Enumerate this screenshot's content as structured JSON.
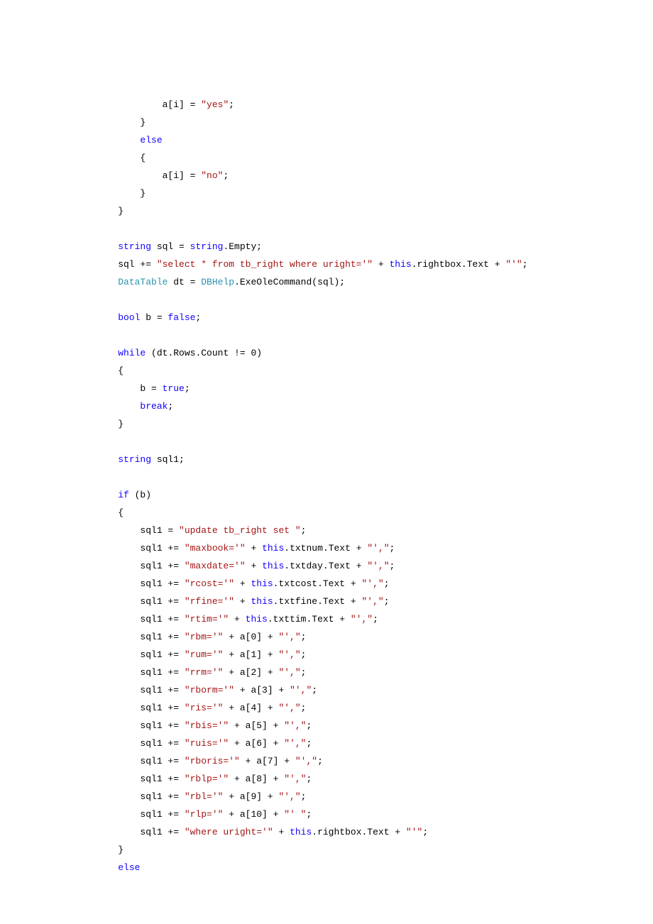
{
  "code": {
    "l1": "            a[i] = \"yes\";",
    "l2": "        }",
    "l3": "        else",
    "l4": "        {",
    "l5": "            a[i] = \"no\";",
    "l6": "        }",
    "l7": "    }",
    "l8": "",
    "l9": "    string sql = string.Empty;",
    "l10": "    sql += \"select * from tb_right where uright='\" + this.rightbox.Text + \"'\";",
    "l11": "    DataTable dt = DBHelp.ExeOleCommand(sql);",
    "l12": "",
    "l13": "    bool b = false;",
    "l14": "",
    "l15": "    while (dt.Rows.Count != 0)",
    "l16": "    {",
    "l17": "        b = true;",
    "l18": "        break;",
    "l19": "    }",
    "l20": "",
    "l21": "    string sql1;",
    "l22": "",
    "l23": "    if (b)",
    "l24": "    {",
    "l25": "        sql1 = \"update tb_right set \";",
    "l26": "        sql1 += \"maxbook='\" + this.txtnum.Text + \"',\";",
    "l27": "        sql1 += \"maxdate='\" + this.txtday.Text + \"',\";",
    "l28": "        sql1 += \"rcost='\" + this.txtcost.Text + \"',\";",
    "l29": "        sql1 += \"rfine='\" + this.txtfine.Text + \"',\";",
    "l30": "        sql1 += \"rtim='\" + this.txttim.Text + \"',\";",
    "l31": "        sql1 += \"rbm='\" + a[0] + \"',\";",
    "l32": "        sql1 += \"rum='\" + a[1] + \"',\";",
    "l33": "        sql1 += \"rrm='\" + a[2] + \"',\";",
    "l34": "        sql1 += \"rborm='\" + a[3] + \"',\";",
    "l35": "        sql1 += \"ris='\" + a[4] + \"',\";",
    "l36": "        sql1 += \"rbis='\" + a[5] + \"',\";",
    "l37": "        sql1 += \"ruis='\" + a[6] + \"',\";",
    "l38": "        sql1 += \"rboris='\" + a[7] + \"',\";",
    "l39": "        sql1 += \"rblp='\" + a[8] + \"',\";",
    "l40": "        sql1 += \"rbl='\" + a[9] + \"',\";",
    "l41": "        sql1 += \"rlp='\" + a[10] + \"' \";",
    "l42": "        sql1 += \"where uright='\" + this.rightbox.Text + \"'\";",
    "l43": "    }",
    "l44": "    else"
  },
  "tokens": {
    "else": "else",
    "string_kw": "string",
    "bool_kw": "bool",
    "false_kw": "false",
    "while_kw": "while",
    "true_kw": "true",
    "break_kw": "break",
    "if_kw": "if",
    "this_kw": "this",
    "DataTable": "DataTable",
    "DBHelp": "DBHelp",
    "s_yes": "\"yes\"",
    "s_no": "\"no\"",
    "s_select": "\"select * from tb_right where uright='\"",
    "s_tick": "\"'\"",
    "s_update": "\"update tb_right set \"",
    "s_maxbook": "\"maxbook='\"",
    "s_comma": "\"',\"",
    "s_maxdate": "\"maxdate='\"",
    "s_rcost": "\"rcost='\"",
    "s_rfine": "\"rfine='\"",
    "s_rtim": "\"rtim='\"",
    "s_rbm": "\"rbm='\"",
    "s_rum": "\"rum='\"",
    "s_rrm": "\"rrm='\"",
    "s_rborm": "\"rborm='\"",
    "s_ris": "\"ris='\"",
    "s_rbis": "\"rbis='\"",
    "s_ruis": "\"ruis='\"",
    "s_rboris": "\"rboris='\"",
    "s_rblp": "\"rblp='\"",
    "s_rbl": "\"rbl='\"",
    "s_rlp": "\"rlp='\"",
    "s_tickspace": "\"' \"",
    "s_where": "\"where uright='\""
  }
}
